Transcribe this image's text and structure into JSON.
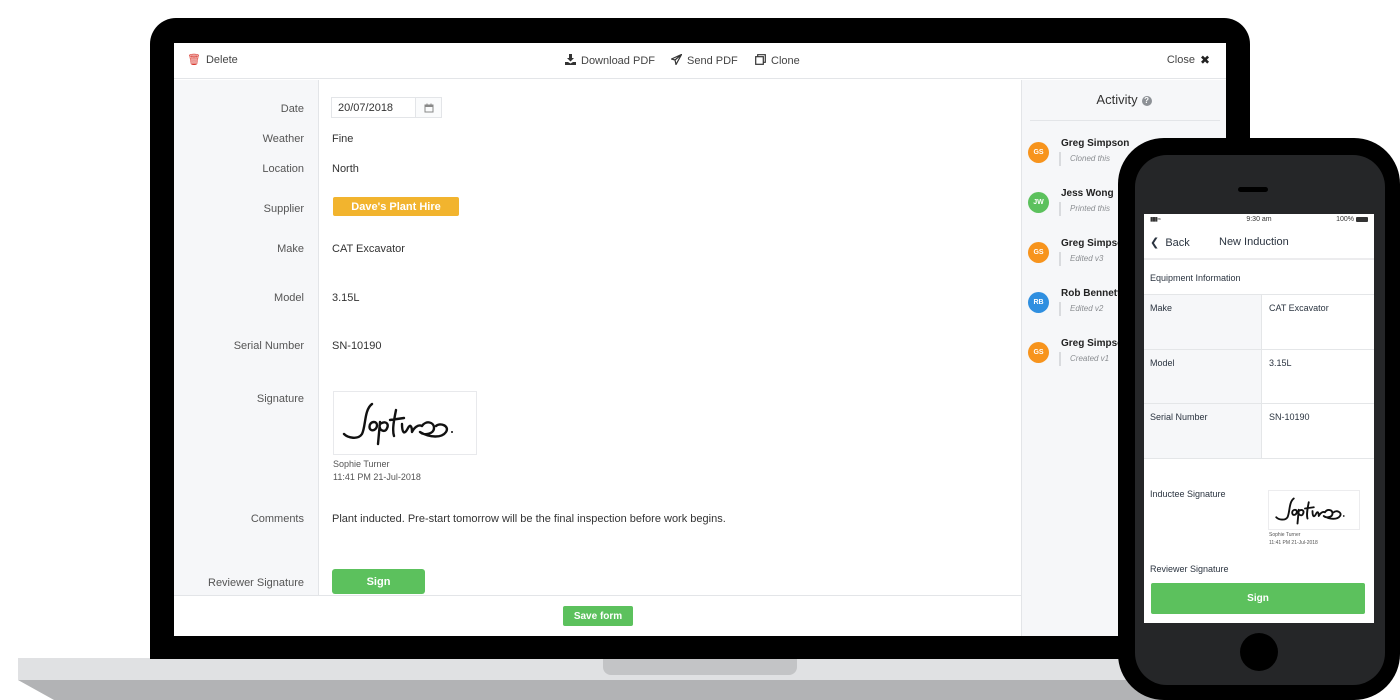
{
  "colors": {
    "accent_green": "#5cc15d",
    "supplier_badge": "#f2b42e",
    "delete_red": "#d9392f",
    "avatar_orange": "#f7941d",
    "avatar_green": "#5cc15d",
    "avatar_blue": "#2f8fe0"
  },
  "toolbar": {
    "delete": {
      "label": "Delete",
      "icon": "trash-icon"
    },
    "download_pdf": {
      "label": "Download PDF",
      "icon": "download-icon"
    },
    "send_pdf": {
      "label": "Send PDF",
      "icon": "paper-plane-icon"
    },
    "clone": {
      "label": "Clone",
      "icon": "clone-icon"
    },
    "close": {
      "label": "Close",
      "icon": "close-icon"
    }
  },
  "form": {
    "date": {
      "label": "Date",
      "value": "20/07/2018"
    },
    "weather": {
      "label": "Weather",
      "value": "Fine"
    },
    "location": {
      "label": "Location",
      "value": "North"
    },
    "supplier": {
      "label": "Supplier",
      "value": "Dave's Plant Hire"
    },
    "make": {
      "label": "Make",
      "value": "CAT Excavator"
    },
    "model": {
      "label": "Model",
      "value": "3.15L"
    },
    "serial": {
      "label": "Serial Number",
      "value": "SN-10190"
    },
    "signature": {
      "label": "Signature",
      "signer": "Sophie Turner",
      "timestamp": "11:41 PM 21-Jul-2018"
    },
    "comments": {
      "label": "Comments",
      "value": "Plant inducted. Pre-start tomorrow will be the final inspection before work begins."
    },
    "reviewer_signature": {
      "label": "Reviewer Signature",
      "button": "Sign"
    },
    "save_label": "Save form"
  },
  "activity": {
    "title": "Activity",
    "help_icon": "question-circle-icon",
    "items": [
      {
        "initials": "GS",
        "name": "Greg Simpson",
        "note": "Cloned this",
        "color": "#f7941d"
      },
      {
        "initials": "JW",
        "name": "Jess Wong",
        "note": "Printed this",
        "color": "#5cc15d"
      },
      {
        "initials": "GS",
        "name": "Greg Simpson",
        "note": "Edited v3",
        "color": "#f7941d"
      },
      {
        "initials": "RB",
        "name": "Rob Bennett",
        "note": "Edited v2",
        "color": "#2f8fe0"
      },
      {
        "initials": "GS",
        "name": "Greg Simpson",
        "note": "Created v1",
        "color": "#f7941d"
      }
    ]
  },
  "phone": {
    "status": {
      "time": "9:30 am",
      "battery": "100%"
    },
    "nav": {
      "back": "Back",
      "title": "New Induction"
    },
    "section": "Equipment Information",
    "rows": [
      {
        "label": "Make",
        "value": "CAT Excavator"
      },
      {
        "label": "Model",
        "value": "3.15L"
      },
      {
        "label": "Serial Number",
        "value": "SN-10190"
      }
    ],
    "inductee_signature": {
      "label": "Inductee Signature",
      "signer": "Sophie Turner",
      "timestamp": "11:41 PM 21-Jul-2018"
    },
    "reviewer_signature": {
      "label": "Reviewer Signature",
      "button": "Sign"
    }
  }
}
